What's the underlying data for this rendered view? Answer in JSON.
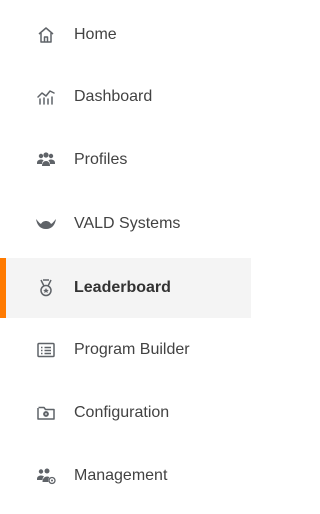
{
  "sidebar": {
    "active_color": "#ff7a00",
    "items": [
      {
        "label": "Home",
        "icon": "home-icon"
      },
      {
        "label": "Dashboard",
        "icon": "chart-icon"
      },
      {
        "label": "Profiles",
        "icon": "people-icon"
      },
      {
        "label": "VALD Systems",
        "icon": "vald-logo-icon"
      },
      {
        "label": "Leaderboard",
        "icon": "medal-icon",
        "active": true
      },
      {
        "label": "Program Builder",
        "icon": "list-icon"
      },
      {
        "label": "Configuration",
        "icon": "folder-settings-icon"
      },
      {
        "label": "Management",
        "icon": "group-settings-icon"
      }
    ]
  }
}
